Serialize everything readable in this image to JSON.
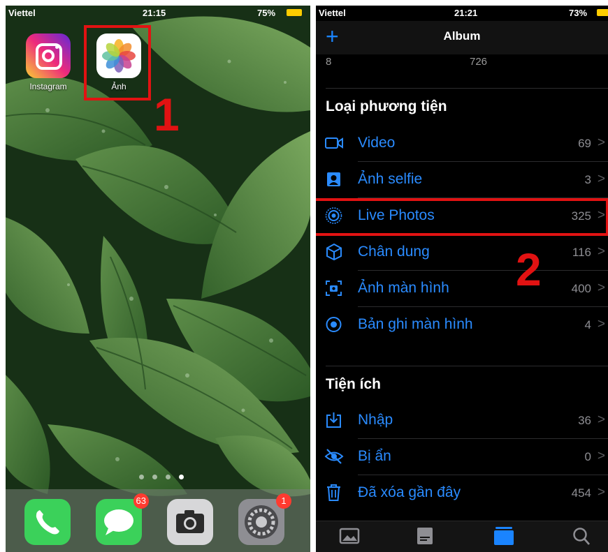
{
  "left": {
    "status": {
      "carrier": "Viettel",
      "time": "21:15",
      "battery": "75%"
    },
    "apps": [
      {
        "label": "Instagram",
        "icon": "instagram-icon"
      },
      {
        "label": "Ảnh",
        "icon": "photos-icon"
      }
    ],
    "annotation_number": "1",
    "page_dots": {
      "count": 4,
      "active": 4
    },
    "dock": [
      {
        "name": "phone",
        "icon": "phone-icon",
        "badge": ""
      },
      {
        "name": "messages",
        "icon": "messages-icon",
        "badge": "63"
      },
      {
        "name": "camera",
        "icon": "camera-icon",
        "badge": ""
      },
      {
        "name": "settings",
        "icon": "settings-icon",
        "badge": "1"
      }
    ]
  },
  "right": {
    "status": {
      "carrier": "Viettel",
      "time": "21:21",
      "battery": "73%"
    },
    "nav": {
      "title": "Album",
      "add_icon": "plus-icon"
    },
    "top_counts": [
      "8",
      "726"
    ],
    "media_section_title": "Loại phương tiện",
    "media_types": [
      {
        "label": "Video",
        "count": "69",
        "icon": "video-icon"
      },
      {
        "label": "Ảnh selfie",
        "count": "3",
        "icon": "selfie-icon"
      },
      {
        "label": "Live Photos",
        "count": "325",
        "icon": "live-photos-icon"
      },
      {
        "label": "Chân dung",
        "count": "116",
        "icon": "portrait-cube-icon"
      },
      {
        "label": "Ảnh màn hình",
        "count": "400",
        "icon": "screenshot-icon"
      },
      {
        "label": "Bản ghi màn hình",
        "count": "4",
        "icon": "screen-record-icon"
      }
    ],
    "utilities_section_title": "Tiện ích",
    "utilities": [
      {
        "label": "Nhập",
        "count": "36",
        "icon": "import-icon"
      },
      {
        "label": "Bị ẩn",
        "count": "0",
        "icon": "hidden-eye-icon"
      },
      {
        "label": "Đã xóa gần đây",
        "count": "454",
        "icon": "trash-icon"
      }
    ],
    "chevron": ">",
    "annotation_number": "2",
    "tabs": [
      {
        "icon": "library-photo-icon",
        "active": false
      },
      {
        "icon": "for-you-icon",
        "active": false
      },
      {
        "icon": "albums-icon",
        "active": true
      },
      {
        "icon": "search-icon",
        "active": false
      }
    ]
  },
  "colors": {
    "accent": "#2a8bff",
    "annotation_red": "#e21212",
    "badge_red": "#ff3b30"
  }
}
